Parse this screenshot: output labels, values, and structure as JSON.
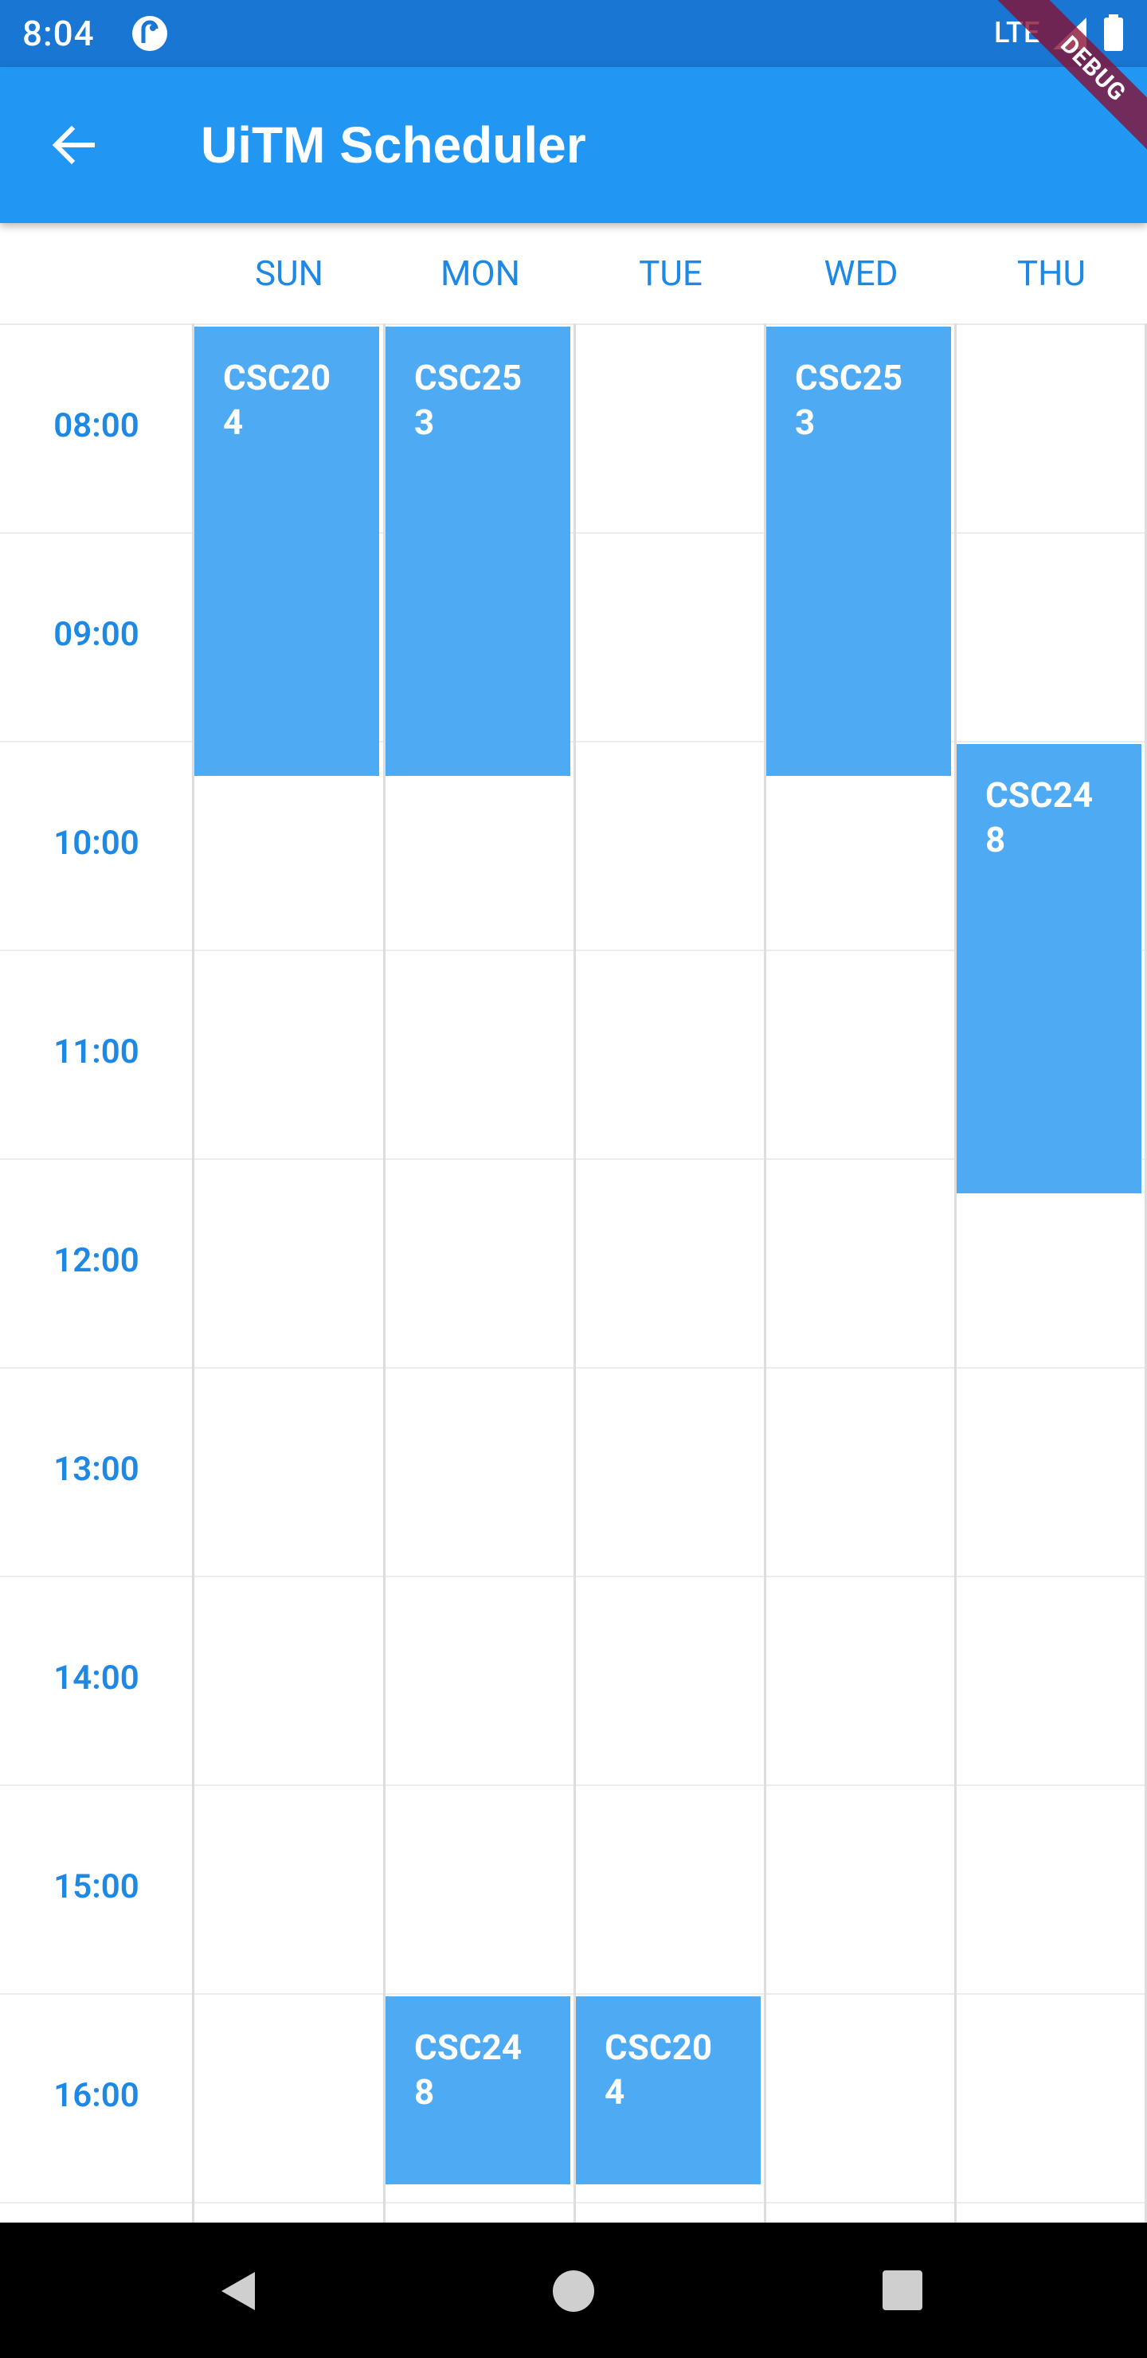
{
  "status_bar": {
    "time": "8:04",
    "network": "LTE",
    "app_icon": "app-notification-icon",
    "signal_icon": "signal-icon",
    "battery_icon": "battery-icon"
  },
  "debug_banner": "DEBUG",
  "app_bar": {
    "title": "UiTM Scheduler",
    "back_icon": "arrow-back-icon"
  },
  "days": [
    "SUN",
    "MON",
    "TUE",
    "WED",
    "THU"
  ],
  "times": [
    "08:00",
    "09:00",
    "10:00",
    "11:00",
    "12:00",
    "13:00",
    "14:00",
    "15:00",
    "16:00"
  ],
  "events": [
    {
      "code": "CSC204",
      "day": "SUN",
      "start": "08:00",
      "end": "10:10"
    },
    {
      "code": "CSC253",
      "day": "MON",
      "start": "08:00",
      "end": "10:10"
    },
    {
      "code": "CSC253",
      "day": "WED",
      "start": "08:00",
      "end": "10:10"
    },
    {
      "code": "CSC248",
      "day": "THU",
      "start": "10:00",
      "end": "12:10"
    },
    {
      "code": "CSC248",
      "day": "MON",
      "start": "16:00",
      "end": "16:55"
    },
    {
      "code": "CSC204",
      "day": "TUE",
      "start": "16:00",
      "end": "16:55"
    }
  ],
  "colors": {
    "status_bar": "#1976d2",
    "app_bar": "#2196f3",
    "event": "#4eaaf3",
    "label_text": "#1e88e5"
  },
  "nav_bar": {
    "back_icon": "nav-back-icon",
    "home_icon": "nav-home-icon",
    "recents_icon": "nav-recents-icon"
  }
}
